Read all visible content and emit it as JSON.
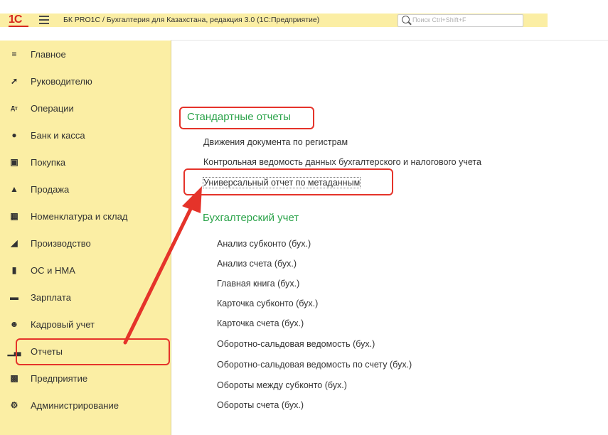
{
  "header": {
    "logo": "1С",
    "title": "БК PRO1C / Бухгалтерия для Казахстана, редакция 3.0  (1С:Предприятие)",
    "search_placeholder": "Поиск Ctrl+Shift+F"
  },
  "sidebar": {
    "items": [
      {
        "label": "Главное",
        "icon": "menu-lines-icon"
      },
      {
        "label": "Руководителю",
        "icon": "trend-icon"
      },
      {
        "label": "Операции",
        "icon": "debit-credit-icon"
      },
      {
        "label": "Банк и касса",
        "icon": "coin-icon"
      },
      {
        "label": "Покупка",
        "icon": "cart-icon"
      },
      {
        "label": "Продажа",
        "icon": "bag-icon"
      },
      {
        "label": "Номенклатура и склад",
        "icon": "grid-icon"
      },
      {
        "label": "Производство",
        "icon": "factory-icon"
      },
      {
        "label": "ОС и НМА",
        "icon": "truck-icon"
      },
      {
        "label": "Зарплата",
        "icon": "wallet-icon"
      },
      {
        "label": "Кадровый учет",
        "icon": "people-icon"
      },
      {
        "label": "Отчеты",
        "icon": "bar-chart-icon"
      },
      {
        "label": "Предприятие",
        "icon": "building-icon"
      },
      {
        "label": "Администрирование",
        "icon": "gear-icon"
      }
    ]
  },
  "content": {
    "standard_title": "Стандартные отчеты",
    "standard_links": [
      "Движения документа по регистрам",
      "Контрольная ведомость данных бухгалтерского и налогового учета",
      "Универсальный отчет по метаданным"
    ],
    "accounting_title": "Бухгалтерский учет",
    "accounting_links": [
      "Анализ субконто (бух.)",
      "Анализ счета (бух.)",
      "Главная книга (бух.)",
      "Карточка субконто (бух.)",
      "Карточка счета (бух.)",
      "Оборотно-сальдовая ведомость (бух.)",
      "Оборотно-сальдовая ведомость по счету (бух.)",
      "Обороты между субконто (бух.)",
      "Обороты счета (бух.)"
    ]
  },
  "colors": {
    "sidebar_bg": "#fbeea4",
    "section_green": "#2ba34a",
    "highlight_red": "#e5332a"
  }
}
